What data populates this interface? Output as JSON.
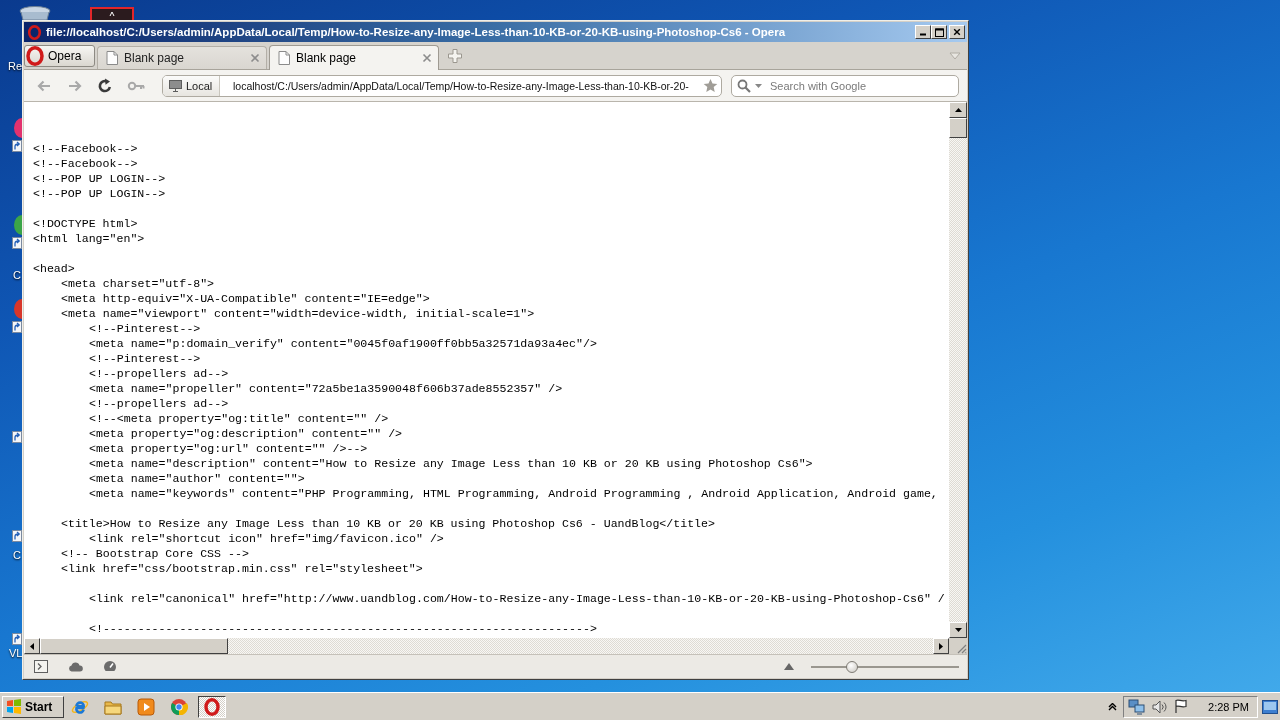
{
  "desktop_icons": [
    {
      "kind": "recycle-bin",
      "label": "Re"
    },
    {
      "kind": "app"
    },
    {
      "kind": "shortcut",
      "color": "#e2326e"
    },
    {
      "kind": "shortcut",
      "color": "#3ba548",
      "label": "C"
    },
    {
      "kind": "shortcut",
      "color": "#d8362a"
    },
    {
      "kind": "shortcut"
    },
    {
      "kind": "shortcut",
      "label": "C"
    },
    {
      "kind": "shortcut",
      "label": "VL"
    }
  ],
  "window": {
    "title": "file://localhost/C:/Users/admin/AppData/Local/Temp/How-to-Resize-any-Image-Less-than-10-KB-or-20-KB-using-Photoshop-Cs6 - Opera"
  },
  "menu_button": {
    "label": "Opera"
  },
  "tabs": [
    {
      "title": "Blank page",
      "selected": false
    },
    {
      "title": "Blank page",
      "selected": true
    }
  ],
  "toolbar_buttons": [
    {
      "kind": "back",
      "disabled": true
    },
    {
      "kind": "forward",
      "disabled": true
    },
    {
      "kind": "reload",
      "disabled": false
    },
    {
      "kind": "key",
      "disabled": true
    }
  ],
  "address_bar": {
    "site_badge": "Local",
    "value": "localhost/C:/Users/admin/AppData/Local/Temp/How-to-Resize-any-Image-Less-than-10-KB-or-20-"
  },
  "search": {
    "placeholder": "Search with Google"
  },
  "source_blocks": [
    {
      "lines": [
        {
          "text": "<!--Facebook-->"
        },
        {
          "text": "<!--Facebook-->"
        },
        {
          "text": "<!--POP UP LOGIN-->"
        },
        {
          "text": "<!--POP UP LOGIN-->"
        }
      ]
    },
    {
      "lines": [
        {
          "text": "<!DOCTYPE html>"
        },
        {
          "text": "<html lang=\"en\">"
        }
      ]
    },
    {
      "lines": [
        {
          "text": "<head>",
          "children": [
            {
              "text": "<meta charset=\"utf-8\">"
            },
            {
              "text": "<meta http-equiv=\"X-UA-Compatible\" content=\"IE=edge\">"
            },
            {
              "text": "<meta name=\"viewport\" content=\"width=device-width, initial-scale=1\">",
              "children": [
                {
                  "text": "<!--Pinterest-->"
                },
                {
                  "text": "<meta name=\"p:domain_verify\" content=\"0045f0af1900ff0bb5a32571da93a4ec\"/>"
                },
                {
                  "text": "<!--Pinterest-->"
                },
                {
                  "text": "<!--propellers ad-->"
                },
                {
                  "text": "<meta name=\"propeller\" content=\"72a5be1a3590048f606b37ade8552357\" />"
                },
                {
                  "text": "<!--propellers ad-->"
                },
                {
                  "text": "<!--<meta property=\"og:title\" content=\"\" />"
                },
                {
                  "text": "<meta property=\"og:description\" content=\"\" />"
                },
                {
                  "text": "<meta property=\"og:url\" content=\"\" />-->"
                },
                {
                  "text": "<meta name=\"description\" content=\"How to Resize any Image Less than 10 KB or 20 KB using Photoshop Cs6\">"
                },
                {
                  "text": "<meta name=\"author\" content=\"\">"
                },
                {
                  "text": "<meta name=\"keywords\" content=\"PHP Programming, HTML Programming, Android Programming , Android Application, Android game,"
                }
              ]
            }
          ]
        }
      ]
    },
    {
      "lines": [
        {
          "children": [
            {
              "text": "<title>How to Resize any Image Less than 10 KB or 20 KB using Photoshop Cs6 - UandBlog</title>",
              "children": [
                {
                  "text": "<link rel=\"shortcut icon\" href=\"img/favicon.ico\" />"
                }
              ]
            },
            {
              "text": "<!-- Bootstrap Core CSS -->"
            },
            {
              "text": "<link href=\"css/bootstrap.min.css\" rel=\"stylesheet\">"
            }
          ]
        }
      ]
    },
    {
      "lines": [
        {
          "children": [
            {
              "children": [
                {
                  "text": "<link rel=\"canonical\" href=\"http://www.uandblog.com/How-to-Resize-any-Image-Less-than-10-KB-or-20-KB-using-Photoshop-Cs6\" /"
                }
              ]
            }
          ]
        }
      ]
    },
    {
      "lines": [
        {
          "children": [
            {
              "children": [
                {
                  "text": "<!---------------------------------------------------------------------->"
                }
              ]
            }
          ]
        }
      ]
    }
  ],
  "status_bar": {
    "zoom": {
      "level": 0.28
    }
  },
  "taskbar": {
    "start": "Start",
    "apps": [
      {
        "kind": "ie",
        "selected": false
      },
      {
        "kind": "folder",
        "selected": false
      },
      {
        "kind": "media",
        "selected": false
      },
      {
        "kind": "chrome",
        "selected": false
      },
      {
        "kind": "opera",
        "selected": true
      }
    ],
    "clock": "2:28 PM"
  }
}
